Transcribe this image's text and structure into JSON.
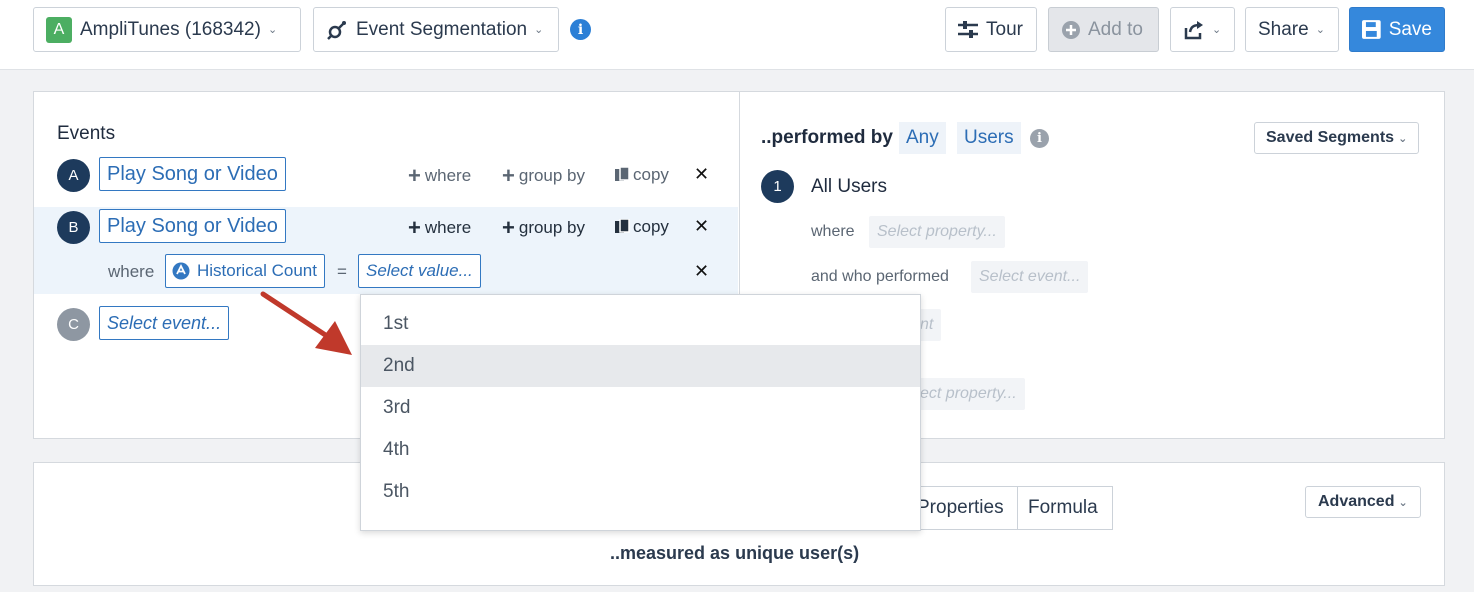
{
  "header": {
    "app_badge": "A",
    "app_name": "AmpliTunes (168342)",
    "chart_type": "Event Segmentation",
    "info": "i",
    "tour": "Tour",
    "add_to": "Add to",
    "share": "Share",
    "save": "Save"
  },
  "events": {
    "title": "Events",
    "rows": [
      {
        "letter": "A",
        "event": "Play Song or Video",
        "where": "where",
        "group_by": "group by",
        "copy": "copy"
      },
      {
        "letter": "B",
        "event": "Play Song or Video",
        "where": "where",
        "group_by": "group by",
        "copy": "copy"
      }
    ],
    "filter": {
      "label": "where",
      "property": "Historical Count",
      "operator": "=",
      "value_placeholder": "Select value..."
    },
    "next": {
      "letter": "C",
      "placeholder": "Select event..."
    }
  },
  "dropdown": {
    "options": [
      "1st",
      "2nd",
      "3rd",
      "4th",
      "5th"
    ],
    "highlighted": "2nd"
  },
  "segment": {
    "performed_by": "..performed by",
    "any": "Any",
    "users": "Users",
    "saved_segments": "Saved Segments",
    "number": "1",
    "name": "All Users",
    "where": "where",
    "where_placeholder": "Select property...",
    "who_performed": "and who performed",
    "event_placeholder": "Select event...",
    "partial_1": "nt",
    "partial_2": "ect property..."
  },
  "measure": {
    "tabs": [
      "Properties",
      "Formula"
    ],
    "advanced": "Advanced",
    "measured_as": "..measured as unique user(s)"
  },
  "colors": {
    "accent": "#2c6db5",
    "save": "#3588dc",
    "event_circle": "#1d3a5c",
    "empty_circle": "#8e97a2",
    "arrow": "#c0392b",
    "app_badge": "#4cae62"
  }
}
